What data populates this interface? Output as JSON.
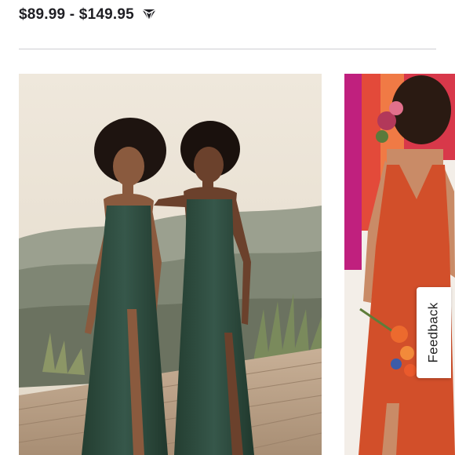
{
  "product": {
    "price_range": "$89.99 - $149.95",
    "badge_icon": "diamond-icon"
  },
  "gallery": {
    "images": [
      {
        "name": "green-dresses-photo",
        "dress_color": "#2f4d3d"
      },
      {
        "name": "orange-dress-photo",
        "dress_color": "#d24f2a"
      }
    ]
  },
  "feedback": {
    "label": "Feedback"
  },
  "colors": {
    "text": "#1f1f24",
    "divider": "#cfcfd3",
    "sky": "#ede4d6",
    "deck": "#c9b29a"
  }
}
